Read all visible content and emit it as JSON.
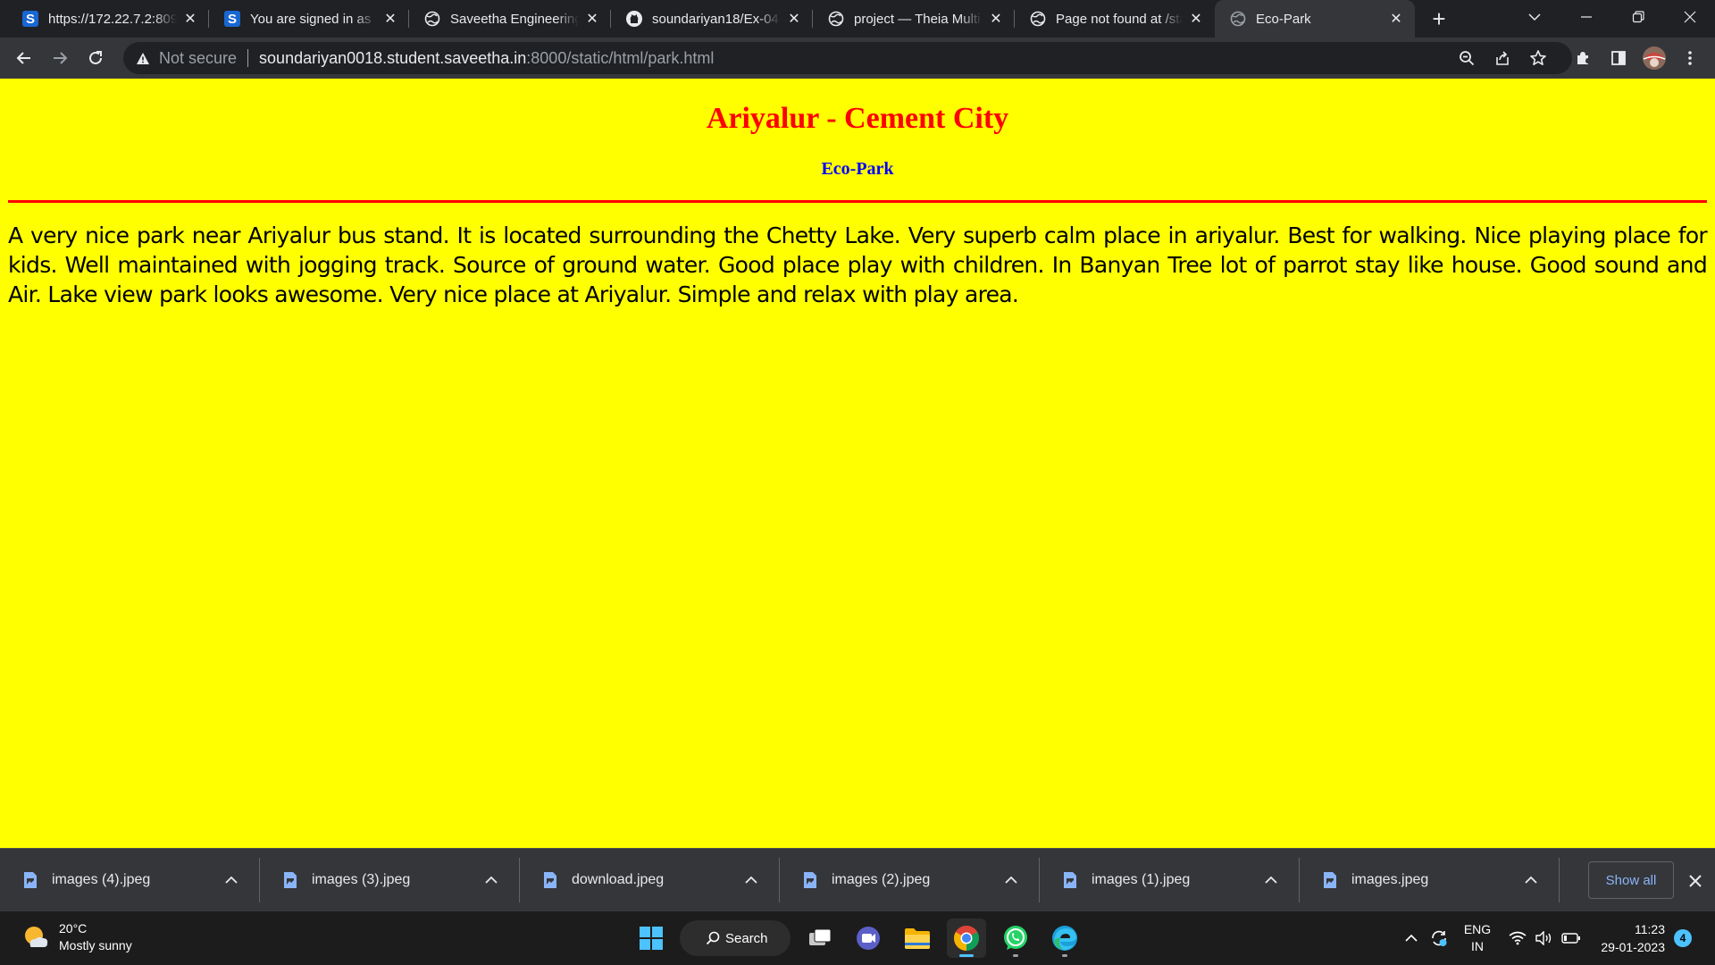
{
  "browser": {
    "tabs": [
      {
        "title": "https://172.22.7.2:8090/",
        "favicon": "s-favicon"
      },
      {
        "title": "You are signed in as 212",
        "favicon": "s-favicon"
      },
      {
        "title": "Saveetha Engineering College",
        "favicon": "globe-icon"
      },
      {
        "title": "soundariyan18/Ex-04-Cities",
        "favicon": "github-icon"
      },
      {
        "title": "project — Theia Multi-Language",
        "favicon": "globe-icon"
      },
      {
        "title": "Page not found at /static",
        "favicon": "globe-icon"
      },
      {
        "title": "Eco-Park",
        "favicon": "globe-icon",
        "active": true
      }
    ],
    "address": {
      "security_label": "Not secure",
      "host": "soundariyan0018.student.saveetha.in",
      "path": ":8000/static/html/park.html"
    }
  },
  "page": {
    "heading": "Ariyalur - Cement City",
    "subheading": "Eco-Park",
    "paragraph": "A very nice park near Ariyalur bus stand. It is located surrounding the Chetty Lake. Very superb calm place in ariyalur. Best for walking. Nice playing place for kids. Well maintained with jogging track. Source of ground water. Good place play with children. In Banyan Tree lot of parrot stay like house. Good sound and Air. Lake view park looks awesome. Very nice place at Ariyalur. Simple and relax with play area.",
    "colors": {
      "background": "#ffff00",
      "heading": "#ff0000",
      "subheading": "#0000ff",
      "rule": "#ff0000"
    }
  },
  "downloads": {
    "items": [
      "images (4).jpeg",
      "images (3).jpeg",
      "download.jpeg",
      "images (2).jpeg",
      "images (1).jpeg",
      "images.jpeg"
    ],
    "show_all_label": "Show all"
  },
  "taskbar": {
    "weather": {
      "temp": "20°C",
      "condition": "Mostly sunny"
    },
    "search_label": "Search",
    "language": {
      "line1": "ENG",
      "line2": "IN"
    },
    "clock": {
      "time": "11:23",
      "date": "29-01-2023"
    },
    "notification_count": "4"
  }
}
